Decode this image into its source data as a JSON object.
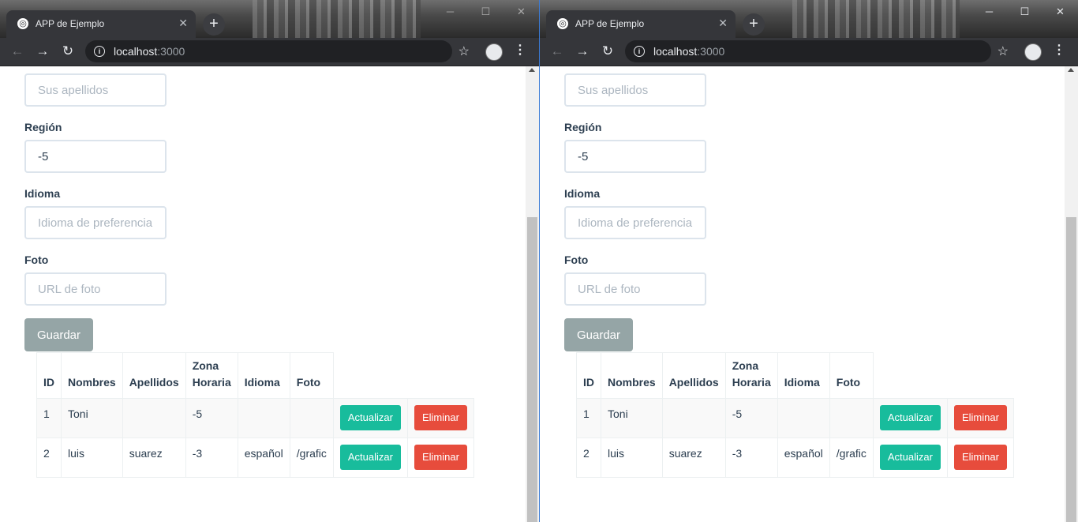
{
  "browser": {
    "tab_title": "APP de Ejemplo",
    "new_tab": "+",
    "url_host": "localhost",
    "url_port": ":3000"
  },
  "form": {
    "apellidos_placeholder": "Sus apellidos",
    "region_label": "Región",
    "region_value": "-5",
    "idioma_label": "Idioma",
    "idioma_placeholder": "Idioma de preferencia",
    "foto_label": "Foto",
    "foto_placeholder": "URL de foto",
    "save_label": "Guardar"
  },
  "table": {
    "headers": [
      "ID",
      "Nombres",
      "Apellidos",
      "Zona Horaria",
      "Idioma",
      "Foto"
    ],
    "rows": [
      {
        "id": "1",
        "nombres": "Toni",
        "apellidos": "",
        "zona": "-5",
        "idioma": "",
        "foto": ""
      },
      {
        "id": "2",
        "nombres": "luis",
        "apellidos": "suarez",
        "zona": "-3",
        "idioma": "español",
        "foto": "/grafic"
      }
    ],
    "update_label": "Actualizar",
    "delete_label": "Eliminar"
  },
  "icons": {
    "tab_icon": "globe-icon",
    "back": "back-arrow-icon",
    "forward": "forward-arrow-icon",
    "reload": "reload-icon",
    "info": "info-icon",
    "star": "bookmark-star-icon",
    "profile": "profile-avatar-icon",
    "menu": "kebab-menu-icon",
    "minimize": "minimize-icon",
    "maximize": "maximize-icon",
    "close": "close-icon"
  },
  "colors": {
    "primary_button": "#95a5a6",
    "update_button": "#18bc9c",
    "delete_button": "#e74c3c",
    "text": "#2c3e50",
    "input_border": "#dce4ec"
  }
}
